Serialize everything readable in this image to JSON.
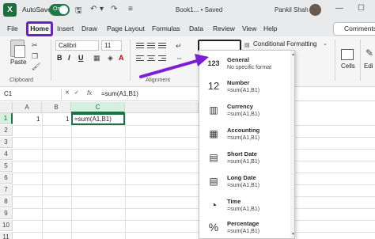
{
  "titlebar": {
    "logo_letter": "X",
    "autosave_label": "AutoSave",
    "autosave_toggle": "On",
    "doc_title": "Book1... • Saved",
    "user_name": "Pankil Shah"
  },
  "menu": {
    "tabs": [
      "File",
      "Home",
      "Insert",
      "Draw",
      "Page Layout",
      "Formulas",
      "Data",
      "Review",
      "View",
      "Help"
    ],
    "comments_label": "Comments"
  },
  "ribbon": {
    "paste_label": "Paste",
    "clipboard_label": "Clipboard",
    "font_name": "Calibri",
    "font_size": "11",
    "bold": "B",
    "italic": "I",
    "underline": "U",
    "alignment_label": "Alignment",
    "conditional_formatting": "Conditional Formatting",
    "cells_label": "Cells",
    "editing_label": "Edi"
  },
  "formulabar": {
    "name_box": "C1",
    "fx": "fx",
    "formula": "=sum(A1,B1)"
  },
  "grid": {
    "columns": [
      "A",
      "B",
      "C"
    ],
    "rows": [
      "1",
      "2",
      "3",
      "4",
      "5",
      "6",
      "7",
      "8",
      "9",
      "10",
      "11"
    ],
    "A1": "1",
    "B1": "1",
    "C1": "=sum(A1,B1)"
  },
  "dropdown": {
    "items": [
      {
        "title": "General",
        "sub": "No specific format",
        "icon": "clock-123-icon"
      },
      {
        "title": "Number",
        "sub": "=sum(A1,B1)",
        "icon": "number-12-icon"
      },
      {
        "title": "Currency",
        "sub": "=sum(A1,B1)",
        "icon": "currency-icon"
      },
      {
        "title": "Accounting",
        "sub": "=sum(A1,B1)",
        "icon": "accounting-icon"
      },
      {
        "title": "Short Date",
        "sub": "=sum(A1,B1)",
        "icon": "calendar-icon"
      },
      {
        "title": "Long Date",
        "sub": "=sum(A1,B1)",
        "icon": "calendar-icon"
      },
      {
        "title": "Time",
        "sub": "=sum(A1,B1)",
        "icon": "clock-icon"
      },
      {
        "title": "Percentage",
        "sub": "=sum(A1,B1)",
        "icon": "percent-icon"
      }
    ]
  },
  "colors": {
    "accent_purple": "#6a1fc9",
    "excel_green": "#1e7145"
  }
}
